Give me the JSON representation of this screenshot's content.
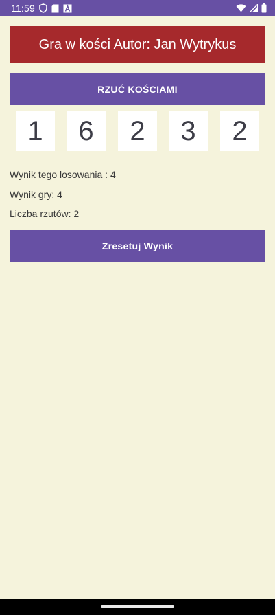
{
  "status_bar": {
    "time": "11:59",
    "left_icons": [
      "shield-icon",
      "sd-card-icon",
      "font-a-icon"
    ],
    "right_icons": [
      "wifi-icon",
      "signal-icon",
      "battery-icon"
    ],
    "color": "#6750a4"
  },
  "header": {
    "title": "Gra w kości Autor: Jan Wytrykus",
    "color": "#a6292c"
  },
  "roll_button": {
    "label": "RZUĆ KOŚCIAMI"
  },
  "dice": [
    "1",
    "6",
    "2",
    "3",
    "2"
  ],
  "results": {
    "round_score": "Wynik tego losowania : 4",
    "game_score": "Wynik gry: 4",
    "throw_count": "Liczba rzutów: 2"
  },
  "reset_button": {
    "label": "Zresetuj Wynik"
  },
  "colors": {
    "background": "#f5f3dc",
    "accent": "#6750a4",
    "die_face": "#ffffff"
  }
}
